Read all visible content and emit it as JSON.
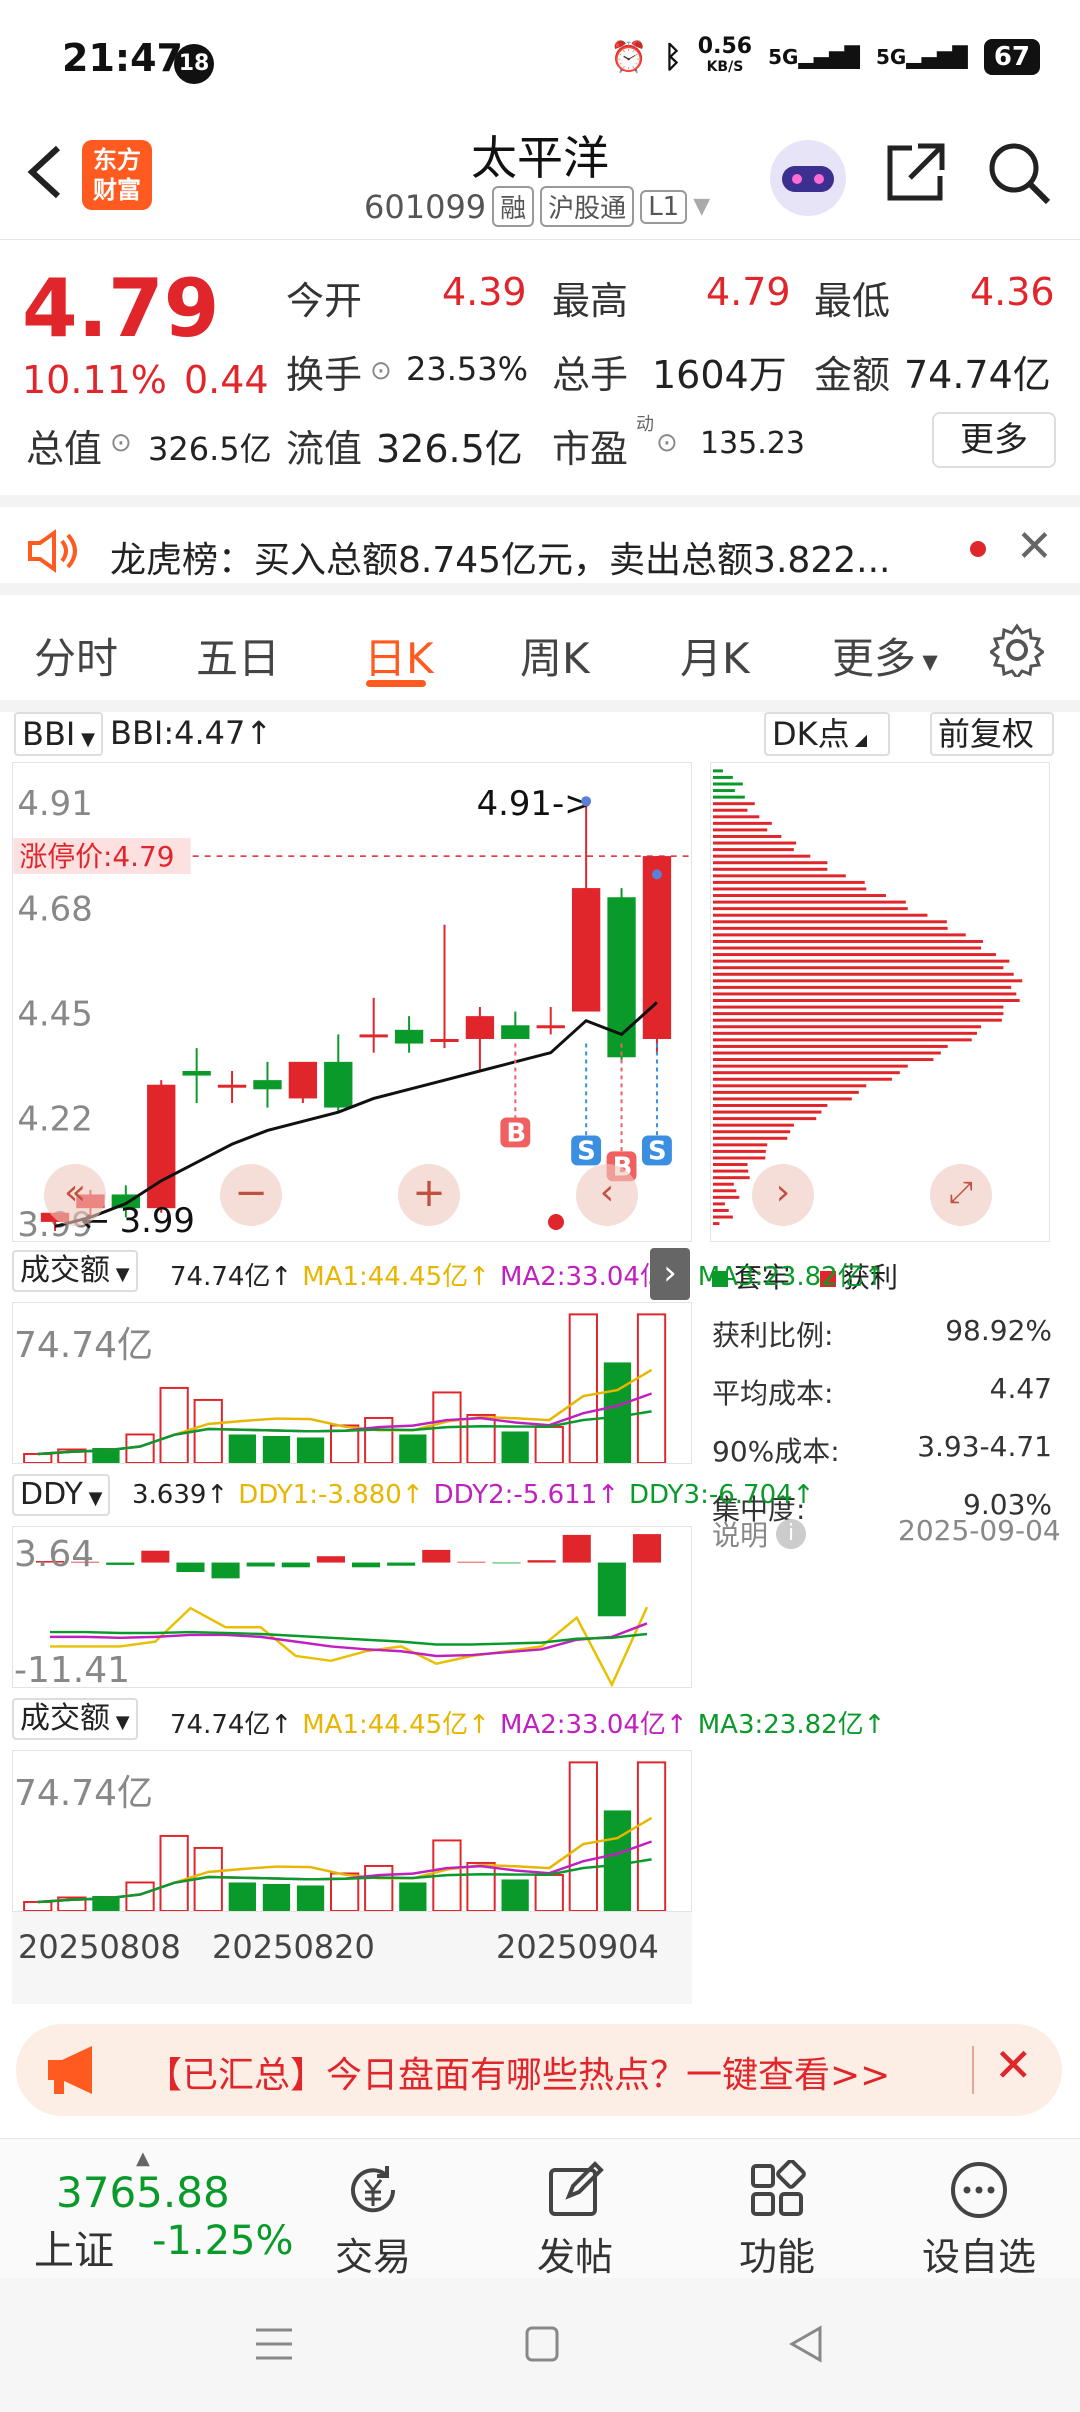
{
  "status": {
    "time": "21:47",
    "badge": "18",
    "net_speed": "0.56",
    "net_unit": "KB/S",
    "sig1": "5G",
    "sig2": "5G",
    "battery": "67"
  },
  "header": {
    "logo": "东方财富",
    "name": "太平洋",
    "code": "601099",
    "tags": [
      "融",
      "沪股通",
      "L1"
    ]
  },
  "quote": {
    "price": "4.79",
    "change_pct": "10.11%",
    "change": "0.44",
    "open_label": "今开",
    "open": "4.39",
    "high_label": "最高",
    "high": "4.79",
    "low_label": "最低",
    "low": "4.36",
    "turnover_label": "换手",
    "turnover": "23.53%",
    "volume_label": "总手",
    "volume": "1604万",
    "amount_label": "金额",
    "amount": "74.74亿",
    "mcap_label": "总值",
    "mcap": "326.5亿",
    "float_label": "流值",
    "float": "326.5亿",
    "pe_label": "市盈",
    "pe_sup": "动",
    "pe": "135.23",
    "more": "更多"
  },
  "notice": {
    "text": "龙虎榜：买入总额8.745亿元，卖出总额3.822..."
  },
  "tabs": [
    "分时",
    "五日",
    "日K",
    "周K",
    "月K",
    "更多"
  ],
  "chart_top": {
    "indicator": "BBI",
    "bbi": "BBI:4.47↑",
    "dk": "DK点",
    "fq": "前复权"
  },
  "chart_data": {
    "type": "candlestick",
    "y_ticks": [
      "4.91",
      "4.68",
      "4.45",
      "4.22",
      "3.99"
    ],
    "limit_label": "涨停价:4.79",
    "high_marker": "4.91->",
    "low_marker": "3.99",
    "signals": [
      "B",
      "S",
      "B",
      "S"
    ],
    "x_ticks": [
      "20250808",
      "20250820",
      "20250904"
    ],
    "ohlc": [
      {
        "o": 3.99,
        "h": 4.01,
        "l": 3.97,
        "c": 4.01
      },
      {
        "o": 4.02,
        "h": 4.06,
        "l": 4.0,
        "c": 4.05
      },
      {
        "o": 4.05,
        "h": 4.07,
        "l": 4.0,
        "c": 4.02
      },
      {
        "o": 4.02,
        "h": 4.3,
        "l": 4.01,
        "c": 4.29
      },
      {
        "o": 4.32,
        "h": 4.37,
        "l": 4.25,
        "c": 4.31
      },
      {
        "o": 4.29,
        "h": 4.32,
        "l": 4.25,
        "c": 4.29
      },
      {
        "o": 4.3,
        "h": 4.34,
        "l": 4.24,
        "c": 4.28
      },
      {
        "o": 4.26,
        "h": 4.33,
        "l": 4.25,
        "c": 4.34
      },
      {
        "o": 4.34,
        "h": 4.4,
        "l": 4.23,
        "c": 4.24
      },
      {
        "o": 4.4,
        "h": 4.48,
        "l": 4.36,
        "c": 4.4
      },
      {
        "o": 4.41,
        "h": 4.44,
        "l": 4.36,
        "c": 4.38
      },
      {
        "o": 4.39,
        "h": 4.64,
        "l": 4.37,
        "c": 4.39
      },
      {
        "o": 4.39,
        "h": 4.46,
        "l": 4.32,
        "c": 4.44
      },
      {
        "o": 4.42,
        "h": 4.45,
        "l": 4.39,
        "c": 4.39
      },
      {
        "o": 4.42,
        "h": 4.46,
        "l": 4.4,
        "c": 4.42
      },
      {
        "o": 4.45,
        "h": 4.91,
        "l": 4.45,
        "c": 4.72
      },
      {
        "o": 4.7,
        "h": 4.72,
        "l": 4.34,
        "c": 4.35
      },
      {
        "o": 4.39,
        "h": 4.79,
        "l": 4.36,
        "c": 4.79
      }
    ],
    "ma": [
      3.98,
      4.0,
      4.03,
      4.08,
      4.12,
      4.16,
      4.19,
      4.21,
      4.23,
      4.26,
      4.28,
      4.3,
      4.32,
      4.34,
      4.36,
      4.43,
      4.4,
      4.47
    ]
  },
  "chip": {
    "legend_trap": "套牢",
    "legend_profit": "获利",
    "rows": [
      {
        "label": "获利比例:",
        "value": "98.92%"
      },
      {
        "label": "平均成本:",
        "value": "4.47"
      },
      {
        "label": "90%成本:",
        "value": "3.93-4.71"
      },
      {
        "label": "集中度:",
        "value": "9.03%"
      }
    ],
    "note": "说明",
    "date": "2025-09-04"
  },
  "amount_panel": {
    "name": "成交额",
    "val": "74.74亿↑",
    "ma1": "MA1:44.45亿↑",
    "ma2": "MA2:33.04亿↑",
    "ma3": "MA3:23.82亿↑",
    "tick": "74.74亿",
    "values": [
      6,
      9,
      10,
      19,
      50,
      42,
      19,
      18,
      17,
      25,
      30,
      19,
      47,
      32,
      21,
      24,
      99,
      67,
      99
    ]
  },
  "ddy_panel": {
    "name": "DDY",
    "val": "3.639↑",
    "ddy1": "DDY1:-3.880↑",
    "ddy2": "DDY2:-5.611↑",
    "ddy3": "DDY3:-6.704↑",
    "top": "3.64",
    "bottom": "-11.41",
    "values": [
      0.2,
      0.1,
      -0.3,
      1.5,
      -1.2,
      -2.0,
      -0.5,
      -0.6,
      0.8,
      -0.6,
      -0.4,
      1.6,
      0.1,
      -0.1,
      0.3,
      3.5,
      -6.8,
      3.6
    ]
  },
  "promo": {
    "text": "【已汇总】今日盘面有哪些热点？一键查看>>"
  },
  "bottom": {
    "index_value": "3765.88",
    "index_name": "上证",
    "index_change": "-1.25%",
    "items": [
      "交易",
      "发帖",
      "功能",
      "设自选"
    ]
  },
  "colors": {
    "up": "#e0262b",
    "down": "#0a9a2a",
    "accent": "#ff5a1f"
  }
}
